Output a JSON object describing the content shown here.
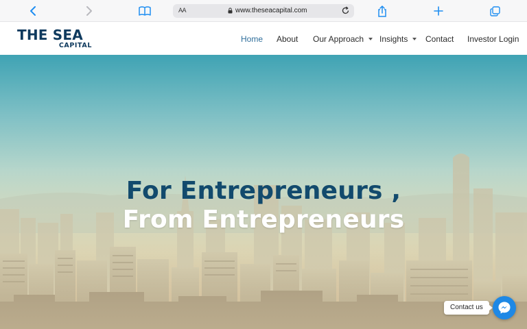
{
  "browser": {
    "aa_label": "AA",
    "url": "www.theseacapital.com",
    "icons": [
      "back-chevron-icon",
      "forward-chevron-icon",
      "book-icon",
      "lock-icon",
      "reload-icon",
      "share-icon",
      "plus-icon",
      "tabs-icon"
    ],
    "accent": "#1f8ef1"
  },
  "logo": {
    "main": "THE SEA",
    "sub": "CAPITAL",
    "color": "#0f3a5e"
  },
  "nav": {
    "items": [
      {
        "label": "Home",
        "active": true
      },
      {
        "label": "About"
      },
      {
        "label": "Our Approach",
        "dropdown": true
      },
      {
        "label": "Insights",
        "dropdown": true
      },
      {
        "label": "Contact"
      },
      {
        "label": "Investor Login"
      }
    ],
    "active_color": "#2f6e9b"
  },
  "hero": {
    "line1": "For Entrepreneurs ,",
    "line2": "From Entrepreneurs",
    "line1_color": "#124a6d",
    "line2_color": "#ffffff"
  },
  "contact_widget": {
    "label": "Contact us",
    "icon": "messenger-icon",
    "color": "#1e88e5"
  }
}
